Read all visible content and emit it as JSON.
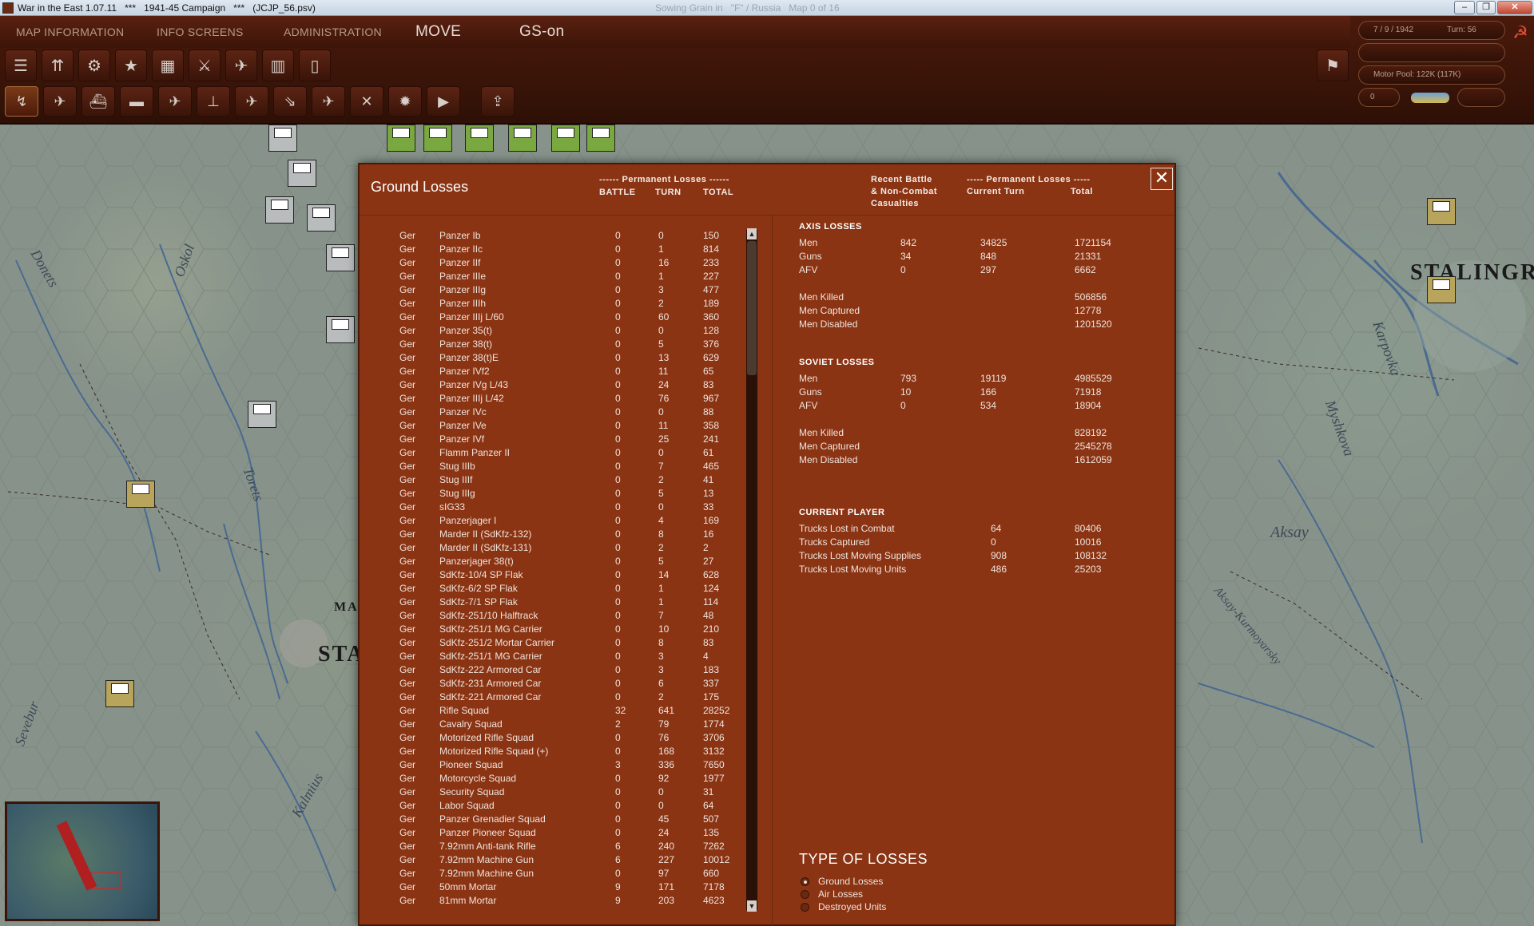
{
  "window": {
    "title": "War in the East 1.07.11",
    "campaign": "***   1941-45 Campaign   ***",
    "file": "(JCJP_56.psv)",
    "center_text": "Sowing Grain in   \"F\" / Russia   Map 0 of 16"
  },
  "menu": {
    "map_information": "MAP INFORMATION",
    "info_screens": "INFO SCREENS",
    "administration": "ADMINISTRATION",
    "mode": "MOVE",
    "gs": "GS-on"
  },
  "status": {
    "date": "7 / 9 / 1942",
    "turn": "Turn: 56",
    "motor_pool": "Motor Pool:  122K (117K)",
    "counter": "0"
  },
  "map_labels": {
    "donets": "Donets",
    "oskol": "Oskol",
    "torets": "Torets",
    "kalmius": "Kalmius",
    "seveburn": "Sevebur",
    "karpovka": "Karpovka",
    "myshkova": "Myshkova",
    "aksay": "Aksay",
    "aksay_kurmoyarsky": "Aksay-Kurmoyarsky",
    "stalingrad": "STALINGRA",
    "sta": "STA",
    "ma": "MA"
  },
  "dialog": {
    "title": "Ground Losses",
    "perm_losses_header": "------ Permanent Losses ------",
    "col_battle": "BATTLE",
    "col_turn": "TURN",
    "col_total": "TOTAL",
    "recent_battle_header": "Recent Battle\n& Non-Combat\nCasualties",
    "perm_losses_right_header": "----- Permanent Losses -----",
    "col_current_turn": "Current Turn",
    "col_total_right": "Total",
    "close": "✕"
  },
  "losses": [
    {
      "nat": "Ger",
      "name": "Panzer Ib",
      "battle": "0",
      "turn": "0",
      "total": "150"
    },
    {
      "nat": "Ger",
      "name": "Panzer IIc",
      "battle": "0",
      "turn": "1",
      "total": "814"
    },
    {
      "nat": "Ger",
      "name": "Panzer IIf",
      "battle": "0",
      "turn": "16",
      "total": "233"
    },
    {
      "nat": "Ger",
      "name": "Panzer IIIe",
      "battle": "0",
      "turn": "1",
      "total": "227"
    },
    {
      "nat": "Ger",
      "name": "Panzer IIIg",
      "battle": "0",
      "turn": "3",
      "total": "477"
    },
    {
      "nat": "Ger",
      "name": "Panzer IIIh",
      "battle": "0",
      "turn": "2",
      "total": "189"
    },
    {
      "nat": "Ger",
      "name": "Panzer IIIj L/60",
      "battle": "0",
      "turn": "60",
      "total": "360"
    },
    {
      "nat": "Ger",
      "name": "Panzer 35(t)",
      "battle": "0",
      "turn": "0",
      "total": "128"
    },
    {
      "nat": "Ger",
      "name": "Panzer 38(t)",
      "battle": "0",
      "turn": "5",
      "total": "376"
    },
    {
      "nat": "Ger",
      "name": "Panzer 38(t)E",
      "battle": "0",
      "turn": "13",
      "total": "629"
    },
    {
      "nat": "Ger",
      "name": "Panzer IVf2",
      "battle": "0",
      "turn": "11",
      "total": "65"
    },
    {
      "nat": "Ger",
      "name": "Panzer IVg L/43",
      "battle": "0",
      "turn": "24",
      "total": "83"
    },
    {
      "nat": "Ger",
      "name": "Panzer IIIj L/42",
      "battle": "0",
      "turn": "76",
      "total": "967"
    },
    {
      "nat": "Ger",
      "name": "Panzer IVc",
      "battle": "0",
      "turn": "0",
      "total": "88"
    },
    {
      "nat": "Ger",
      "name": "Panzer IVe",
      "battle": "0",
      "turn": "11",
      "total": "358"
    },
    {
      "nat": "Ger",
      "name": "Panzer IVf",
      "battle": "0",
      "turn": "25",
      "total": "241"
    },
    {
      "nat": "Ger",
      "name": "Flamm Panzer II",
      "battle": "0",
      "turn": "0",
      "total": "61"
    },
    {
      "nat": "Ger",
      "name": "Stug IIIb",
      "battle": "0",
      "turn": "7",
      "total": "465"
    },
    {
      "nat": "Ger",
      "name": "Stug IIIf",
      "battle": "0",
      "turn": "2",
      "total": "41"
    },
    {
      "nat": "Ger",
      "name": "Stug IIIg",
      "battle": "0",
      "turn": "5",
      "total": "13"
    },
    {
      "nat": "Ger",
      "name": "sIG33",
      "battle": "0",
      "turn": "0",
      "total": "33"
    },
    {
      "nat": "Ger",
      "name": "Panzerjager I",
      "battle": "0",
      "turn": "4",
      "total": "169"
    },
    {
      "nat": "Ger",
      "name": "Marder II (SdKfz-132)",
      "battle": "0",
      "turn": "8",
      "total": "16"
    },
    {
      "nat": "Ger",
      "name": "Marder II (SdKfz-131)",
      "battle": "0",
      "turn": "2",
      "total": "2"
    },
    {
      "nat": "Ger",
      "name": "Panzerjager 38(t)",
      "battle": "0",
      "turn": "5",
      "total": "27"
    },
    {
      "nat": "Ger",
      "name": "SdKfz-10/4 SP Flak",
      "battle": "0",
      "turn": "14",
      "total": "628"
    },
    {
      "nat": "Ger",
      "name": "SdKfz-6/2 SP Flak",
      "battle": "0",
      "turn": "1",
      "total": "124"
    },
    {
      "nat": "Ger",
      "name": "SdKfz-7/1 SP Flak",
      "battle": "0",
      "turn": "1",
      "total": "114"
    },
    {
      "nat": "Ger",
      "name": "SdKfz-251/10 Halftrack",
      "battle": "0",
      "turn": "7",
      "total": "48"
    },
    {
      "nat": "Ger",
      "name": "SdKfz-251/1 MG Carrier",
      "battle": "0",
      "turn": "10",
      "total": "210"
    },
    {
      "nat": "Ger",
      "name": "SdKfz-251/2 Mortar Carrier",
      "battle": "0",
      "turn": "8",
      "total": "83"
    },
    {
      "nat": "Ger",
      "name": "SdKfz-251/1 MG Carrier",
      "battle": "0",
      "turn": "3",
      "total": "4"
    },
    {
      "nat": "Ger",
      "name": "SdKfz-222 Armored Car",
      "battle": "0",
      "turn": "3",
      "total": "183"
    },
    {
      "nat": "Ger",
      "name": "SdKfz-231 Armored Car",
      "battle": "0",
      "turn": "6",
      "total": "337"
    },
    {
      "nat": "Ger",
      "name": "SdKfz-221 Armored Car",
      "battle": "0",
      "turn": "2",
      "total": "175"
    },
    {
      "nat": "Ger",
      "name": "Rifle Squad",
      "battle": "32",
      "turn": "641",
      "total": "28252"
    },
    {
      "nat": "Ger",
      "name": "Cavalry Squad",
      "battle": "2",
      "turn": "79",
      "total": "1774"
    },
    {
      "nat": "Ger",
      "name": "Motorized Rifle Squad",
      "battle": "0",
      "turn": "76",
      "total": "3706"
    },
    {
      "nat": "Ger",
      "name": "Motorized Rifle Squad (+)",
      "battle": "0",
      "turn": "168",
      "total": "3132"
    },
    {
      "nat": "Ger",
      "name": "Pioneer Squad",
      "battle": "3",
      "turn": "336",
      "total": "7650"
    },
    {
      "nat": "Ger",
      "name": "Motorcycle Squad",
      "battle": "0",
      "turn": "92",
      "total": "1977"
    },
    {
      "nat": "Ger",
      "name": "Security Squad",
      "battle": "0",
      "turn": "0",
      "total": "31"
    },
    {
      "nat": "Ger",
      "name": "Labor Squad",
      "battle": "0",
      "turn": "0",
      "total": "64"
    },
    {
      "nat": "Ger",
      "name": "Panzer Grenadier Squad",
      "battle": "0",
      "turn": "45",
      "total": "507"
    },
    {
      "nat": "Ger",
      "name": "Panzer Pioneer Squad",
      "battle": "0",
      "turn": "24",
      "total": "135"
    },
    {
      "nat": "Ger",
      "name": "7.92mm Anti-tank Rifle",
      "battle": "6",
      "turn": "240",
      "total": "7262"
    },
    {
      "nat": "Ger",
      "name": "7.92mm Machine Gun",
      "battle": "6",
      "turn": "227",
      "total": "10012"
    },
    {
      "nat": "Ger",
      "name": "7.92mm Machine Gun",
      "battle": "0",
      "turn": "97",
      "total": "660"
    },
    {
      "nat": "Ger",
      "name": "50mm Mortar",
      "battle": "9",
      "turn": "171",
      "total": "7178"
    },
    {
      "nat": "Ger",
      "name": "81mm Mortar",
      "battle": "9",
      "turn": "203",
      "total": "4623"
    }
  ],
  "axis_losses": {
    "heading": "AXIS LOSSES",
    "rows": [
      {
        "label": "Men",
        "recent": "842",
        "current": "34825",
        "total": "1721154"
      },
      {
        "label": "Guns",
        "recent": "34",
        "current": "848",
        "total": "21331"
      },
      {
        "label": "AFV",
        "recent": "0",
        "current": "297",
        "total": "6662"
      }
    ],
    "detail": [
      {
        "label": "Men Killed",
        "total": "506856"
      },
      {
        "label": "Men Captured",
        "total": "12778"
      },
      {
        "label": "Men Disabled",
        "total": "1201520"
      }
    ]
  },
  "soviet_losses": {
    "heading": "SOVIET LOSSES",
    "rows": [
      {
        "label": "Men",
        "recent": "793",
        "current": "19119",
        "total": "4985529"
      },
      {
        "label": "Guns",
        "recent": "10",
        "current": "166",
        "total": "71918"
      },
      {
        "label": "AFV",
        "recent": "0",
        "current": "534",
        "total": "18904"
      }
    ],
    "detail": [
      {
        "label": "Men Killed",
        "total": "828192"
      },
      {
        "label": "Men Captured",
        "total": "2545278"
      },
      {
        "label": "Men Disabled",
        "total": "1612059"
      }
    ]
  },
  "current_player": {
    "heading": "CURRENT PLAYER",
    "rows": [
      {
        "label": "Trucks Lost in Combat",
        "current": "64",
        "total": "80406"
      },
      {
        "label": "Trucks Captured",
        "current": "0",
        "total": "10016"
      },
      {
        "label": "Trucks Lost Moving Supplies",
        "current": "908",
        "total": "108132"
      },
      {
        "label": "Trucks Lost Moving Units",
        "current": "486",
        "total": "25203"
      }
    ]
  },
  "type_of_losses": {
    "heading": "TYPE OF LOSSES",
    "options": [
      "Ground Losses",
      "Air Losses",
      "Destroyed Units"
    ],
    "selected": "Ground Losses"
  }
}
